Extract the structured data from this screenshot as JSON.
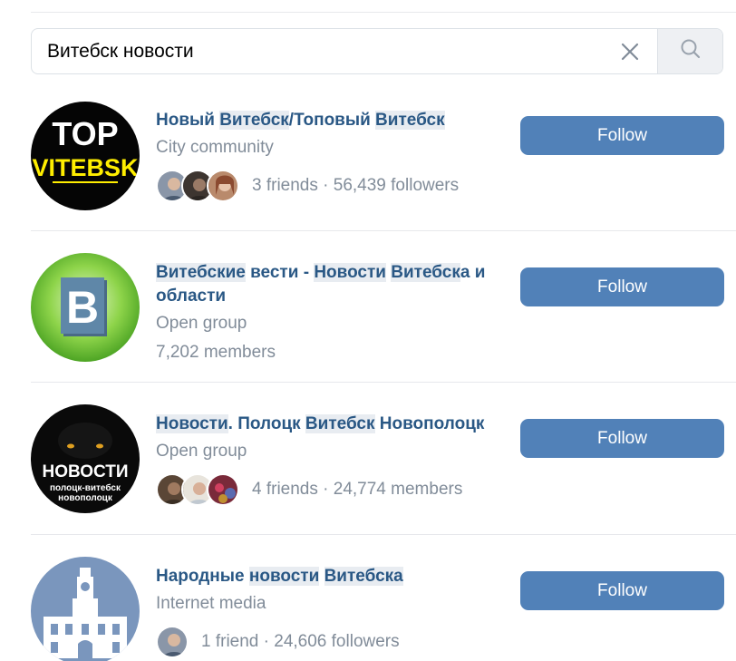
{
  "search": {
    "query": "Витебск новости"
  },
  "results": [
    {
      "name_parts": [
        {
          "text": "Новый ",
          "hl": false
        },
        {
          "text": "Витебск",
          "hl": true
        },
        {
          "text": "/Топовый ",
          "hl": false
        },
        {
          "text": "Витебск",
          "hl": true
        }
      ],
      "subtitle": "City community",
      "friends_text": "3 friends · 56,439 followers",
      "avatar_text": {
        "line1": "TOP",
        "line2": "VITEBSK"
      },
      "follow_label": "Follow"
    },
    {
      "name_parts": [
        {
          "text": "Витебские",
          "hl": true
        },
        {
          "text": " вести - ",
          "hl": false
        },
        {
          "text": "Новости",
          "hl": true
        },
        {
          "text": " ",
          "hl": false
        },
        {
          "text": "Витебск",
          "hl": true
        },
        {
          "text": "а и области",
          "hl": false
        }
      ],
      "subtitle": "Open group",
      "members_text": "7,202 members",
      "avatar_text": {
        "letter": "B"
      },
      "follow_label": "Follow"
    },
    {
      "name_parts": [
        {
          "text": "Новости",
          "hl": true
        },
        {
          "text": ". Полоцк ",
          "hl": false
        },
        {
          "text": "Витебск",
          "hl": true
        },
        {
          "text": " Новополоцк",
          "hl": false
        }
      ],
      "subtitle": "Open group",
      "friends_text": "4 friends · 24,774 members",
      "avatar_text": {
        "line1": "НОВОСТИ",
        "line2": "полоцк-витебск",
        "line3": "новополоцк"
      },
      "follow_label": "Follow"
    },
    {
      "name_parts": [
        {
          "text": "Народные ",
          "hl": false
        },
        {
          "text": "новости",
          "hl": true
        },
        {
          "text": " ",
          "hl": false
        },
        {
          "text": "Витебска",
          "hl": true
        }
      ],
      "subtitle": "Internet media",
      "friends_text": "1 friend · 24,606 followers",
      "follow_label": "Follow"
    }
  ],
  "colors": {
    "accent": "#5181b8",
    "link": "#2a5885",
    "secondary_text": "#818c99",
    "highlight": "#e8ecf1"
  },
  "icons": {
    "clear": "close-icon",
    "search": "search-icon"
  }
}
